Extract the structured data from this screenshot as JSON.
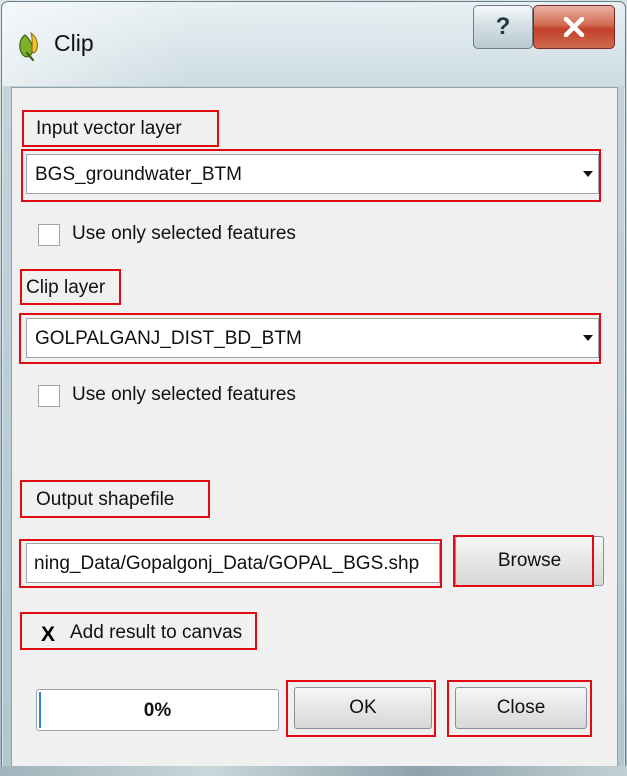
{
  "window": {
    "title": "Clip",
    "help_symbol": "?",
    "close_symbol": "X"
  },
  "input_layer": {
    "label": "Input vector layer",
    "value": "BGS_groundwater_BTM",
    "selected_only_label": "Use only selected features",
    "selected_only_checked": false
  },
  "clip_layer": {
    "label": "Clip layer",
    "value": "GOLPALGANJ_DIST_BD_BTM",
    "selected_only_label": "Use only selected features",
    "selected_only_checked": false
  },
  "output": {
    "label": "Output shapefile",
    "path": "ning_Data/Gopalgonj_Data/GOPAL_BGS.shp",
    "browse_label": "Browse"
  },
  "add_result": {
    "label": "Add result to canvas",
    "checked": true,
    "mark": "X"
  },
  "progress": {
    "value": 0,
    "text": "0%"
  },
  "buttons": {
    "ok": "OK",
    "close": "Close"
  },
  "colors": {
    "highlight": "#e10a10",
    "close_button": "#c2412a",
    "progress_fill": "#2f7fd6"
  }
}
